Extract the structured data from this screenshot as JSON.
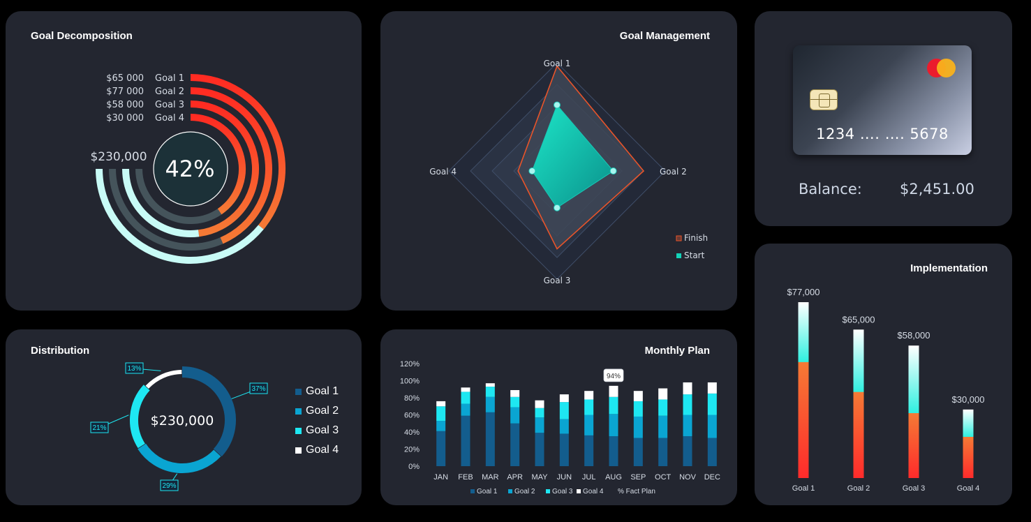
{
  "goal_decomposition": {
    "title": "Goal Decomposition",
    "center_label": "42%",
    "total_label": "$230,000",
    "rows": [
      {
        "amount": "$65 000",
        "goal": "Goal  1"
      },
      {
        "amount": "$77 000",
        "goal": "Goal  2"
      },
      {
        "amount": "$58 000",
        "goal": "Goal  3"
      },
      {
        "amount": "$30 000",
        "goal": "Goal  4"
      }
    ]
  },
  "goal_management": {
    "title": "Goal Management",
    "axis_labels": [
      "Goal 1",
      "Goal 2",
      "Goal 3",
      "Goal 4"
    ],
    "legend": [
      "Finish",
      "Start"
    ]
  },
  "card": {
    "number": "1234 …. …. 5678",
    "balance_label": "Balance:",
    "balance_value": "$2,451.00"
  },
  "distribution": {
    "title": "Distribution",
    "center_label": "$230,000",
    "legend": [
      "Goal 1",
      "Goal 2",
      "Goal 3",
      "Goal 4"
    ]
  },
  "monthly_plan": {
    "title": "Monthly Plan",
    "tooltip": "94%",
    "legend": [
      "Goal 1",
      "Goal 2",
      "Goal 3",
      "Goal 4",
      "% Fact Plan"
    ]
  },
  "implementation": {
    "title": "Implementation"
  },
  "colors": {
    "panel_bg": "#232630",
    "goal1": "#135d8d",
    "goal2": "#0aa5d2",
    "goal3": "#1ee7f2",
    "goal4": "#ffffff",
    "finish_line": "#e8542a",
    "start_fill": "#13d3b8",
    "grad_red": "#ff2b22",
    "grad_orange": "#f57a35",
    "ring_light": "#c8fbf6",
    "ring_dark": "#45545b"
  },
  "chart_data": [
    {
      "id": "goal-decomposition",
      "type": "radial-bar",
      "title": "Goal Decomposition",
      "categories": [
        "Goal 1",
        "Goal 2",
        "Goal 3",
        "Goal 4"
      ],
      "values": [
        65000,
        77000,
        58000,
        30000
      ],
      "progress_fraction": [
        0.48,
        0.58,
        0.64,
        0.54
      ],
      "total": 230000,
      "overall_progress_pct": 42
    },
    {
      "id": "goal-management",
      "type": "radar",
      "title": "Goal Management",
      "categories": [
        "Goal 1",
        "Goal 2",
        "Goal 3",
        "Goal 4"
      ],
      "rmax": 1.0,
      "series": [
        {
          "name": "Finish",
          "values": [
            0.97,
            0.8,
            0.72,
            0.36
          ]
        },
        {
          "name": "Start",
          "values": [
            0.61,
            0.52,
            0.34,
            0.23
          ]
        }
      ]
    },
    {
      "id": "distribution",
      "type": "donut",
      "title": "Distribution",
      "categories": [
        "Goal 1",
        "Goal 2",
        "Goal 3",
        "Goal 4"
      ],
      "values": [
        37,
        29,
        21,
        13
      ],
      "data_labels": [
        "37%",
        "29%",
        "21%",
        "13%"
      ],
      "center": "$230,000"
    },
    {
      "id": "monthly-plan",
      "type": "bar",
      "stacked": true,
      "title": "Monthly Plan",
      "categories": [
        "JAN",
        "FEB",
        "MAR",
        "APR",
        "MAY",
        "JUN",
        "JUL",
        "AUG",
        "SEP",
        "OCT",
        "NOV",
        "DEC"
      ],
      "series": [
        {
          "name": "Goal 1",
          "values": [
            41,
            59,
            63,
            50,
            39,
            38,
            36,
            35,
            33,
            33,
            35,
            33
          ]
        },
        {
          "name": "Goal 2",
          "values": [
            12,
            14,
            18,
            19,
            18,
            17,
            24,
            26,
            25,
            26,
            25,
            27
          ]
        },
        {
          "name": "Goal 3",
          "values": [
            17,
            14,
            12,
            12,
            11,
            20,
            18,
            20,
            18,
            19,
            24,
            25
          ]
        },
        {
          "name": "Goal 4",
          "values": [
            6,
            5,
            4,
            8,
            9,
            9,
            10,
            13,
            12,
            13,
            14,
            13
          ]
        }
      ],
      "yticks": [
        "0%",
        "20%",
        "40%",
        "60%",
        "80%",
        "100%",
        "120%"
      ],
      "ylim": [
        0,
        120
      ],
      "legend": [
        "Goal 1",
        "Goal 2",
        "Goal 3",
        "Goal 4",
        "% Fact Plan"
      ],
      "annotation": {
        "category": "AUG",
        "label": "94%"
      }
    },
    {
      "id": "implementation",
      "type": "bar",
      "title": "Implementation",
      "categories": [
        "Goal 1",
        "Goal 2",
        "Goal 3",
        "Goal 4"
      ],
      "values": [
        77000,
        65000,
        58000,
        30000
      ],
      "data_labels": [
        "$77,000",
        "$65,000",
        "$58,000",
        "$30,000"
      ],
      "ylim": [
        0,
        77000
      ]
    }
  ]
}
